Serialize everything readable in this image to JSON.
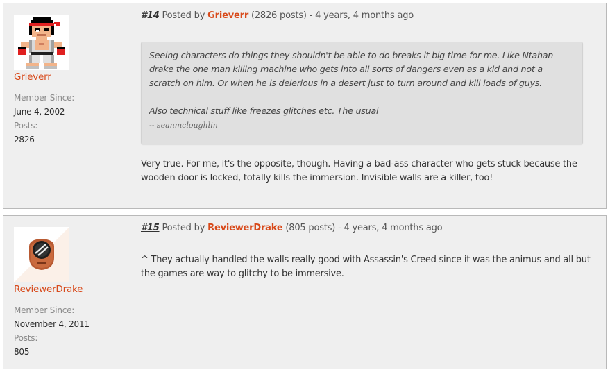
{
  "colors": {
    "accent": "#d84a1b",
    "post_bg": "#efefef",
    "quote_bg": "#e0e0e0"
  },
  "posts": [
    {
      "post_number": "#14",
      "posted_by_label": "Posted by",
      "author": "Grieverr",
      "post_count_text": "(2826 posts) - 4 years, 4 months ago",
      "avatar_icon": "pixel-fighter-avatar",
      "member_since_label": "Member Since:",
      "member_since": "June 4, 2002",
      "posts_label": "Posts:",
      "posts_count": "2826",
      "quote": {
        "paragraphs": [
          "Seeing characters do things they shouldn't be able to do breaks it big time for me. Like Ntahan drake the one man killing machine who gets into all sorts of dangers even as a kid and not a scratch on him. Or when he is delerious in a desert just to turn around and kill loads of guys.",
          "Also technical stuff like freezes glitches etc. The usual"
        ],
        "attribution": "-- seanmcloughlin"
      },
      "body": "Very true. For me, it's the opposite, though. Having a bad-ass character who gets stuck because the wooden door is locked, totally kills the immersion. Invisible walls are a killer, too!"
    },
    {
      "post_number": "#15",
      "posted_by_label": "Posted by",
      "author": "ReviewerDrake",
      "post_count_text": "(805 posts) - 4 years, 4 months ago",
      "avatar_icon": "sunglasses-face-avatar",
      "member_since_label": "Member Since:",
      "member_since": "November 4, 2011",
      "posts_label": "Posts:",
      "posts_count": "805",
      "body": "^ They actually handled the walls really good with Assassin's Creed since it was the animus and all but the games are way to glitchy to be immersive."
    }
  ]
}
